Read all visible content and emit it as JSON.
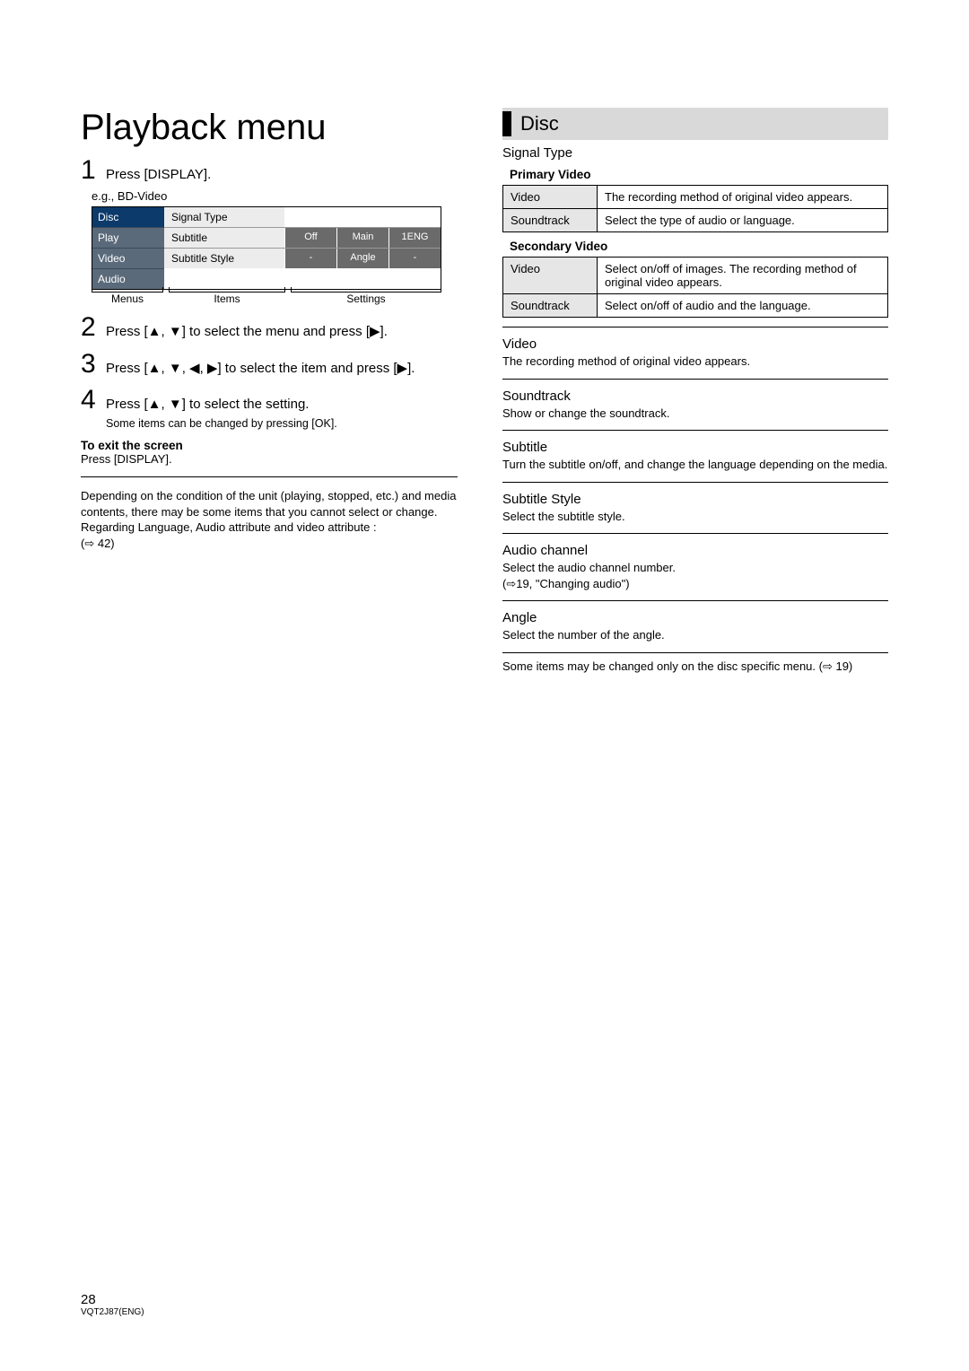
{
  "left": {
    "title": "Playback menu",
    "step1": "Press [DISPLAY].",
    "egLabel": "e.g., BD-Video",
    "menuGraphic": {
      "leftCells": [
        "Disc",
        "Play",
        "Video",
        "Audio"
      ],
      "rows": [
        {
          "label": "Signal Type",
          "settings": []
        },
        {
          "label": "Subtitle",
          "settings": [
            "Off",
            "Main",
            "1ENG"
          ]
        },
        {
          "label": "Subtitle Style",
          "settings": [
            "-",
            "Angle",
            "-"
          ]
        }
      ],
      "brackets": [
        "Menus",
        "Items",
        "Settings"
      ]
    },
    "step2": "Press [▲, ▼] to select the menu and press [▶].",
    "step3": "Press [▲, ▼, ◀, ▶] to select the item and press [▶].",
    "step4": "Press [▲, ▼] to select the setting.",
    "step4Note": "Some items can be changed by pressing [OK].",
    "exitLabel": "To exit the screen",
    "exitText": "Press [DISPLAY].",
    "conditionNote": "Depending on the condition of the unit (playing, stopped, etc.) and media contents, there may be some items that you cannot select or change.",
    "langNote": "Regarding Language, Audio attribute and video attribute :",
    "langRef": "(⇨ 42)"
  },
  "right": {
    "sectionTitle": "Disc",
    "signalType": "Signal Type",
    "primaryLabel": "Primary Video",
    "primaryTable": [
      {
        "k": "Video",
        "v": "The recording method of original video appears."
      },
      {
        "k": "Soundtrack",
        "v": "Select the type of audio or language."
      }
    ],
    "secondaryLabel": "Secondary Video",
    "secondaryTable": [
      {
        "k": "Video",
        "v": "Select on/off of images. The recording method of original video appears."
      },
      {
        "k": "Soundtrack",
        "v": "Select on/off of audio and the language."
      }
    ],
    "entries": [
      {
        "t": "Video",
        "d": "The recording method of original video appears."
      },
      {
        "t": "Soundtrack",
        "d": "Show or change the soundtrack."
      },
      {
        "t": "Subtitle",
        "d": "Turn the subtitle on/off, and change the language depending on the media."
      },
      {
        "t": "Subtitle Style",
        "d": "Select the subtitle style."
      },
      {
        "t": "Audio channel",
        "d": "Select the audio channel number.\n(⇨19, \"Changing audio\")"
      },
      {
        "t": "Angle",
        "d": "Select the number of the angle."
      }
    ],
    "footnote": "Some items may be changed only on the disc specific menu. (⇨ 19)"
  },
  "footer": {
    "page": "28",
    "code": "VQT2J87(ENG)"
  }
}
